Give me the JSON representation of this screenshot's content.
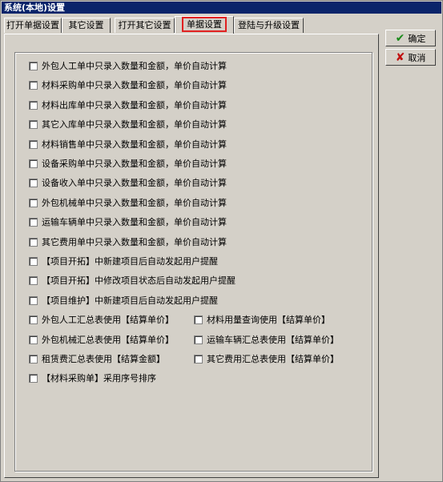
{
  "window": {
    "title": "系统(本地)设置"
  },
  "tabs": [
    {
      "label": "打开单据设置"
    },
    {
      "label": "其它设置"
    },
    {
      "label": "打开其它设置"
    },
    {
      "label": "单据设置"
    },
    {
      "label": "登陆与升级设置"
    }
  ],
  "active_tab": "单据设置",
  "buttons": {
    "ok_label": "确定",
    "cancel_label": "取消"
  },
  "options": [
    {
      "label": "外包人工单中只录入数量和金额，单价自动计算",
      "checked": false
    },
    {
      "label": "材料采购单中只录入数量和金额，单价自动计算",
      "checked": false
    },
    {
      "label": "材料出库单中只录入数量和金额，单价自动计算",
      "checked": false
    },
    {
      "label": "其它入库单中只录入数量和金额，单价自动计算",
      "checked": false
    },
    {
      "label": "材料销售单中只录入数量和金额，单价自动计算",
      "checked": false
    },
    {
      "label": "设备采购单中只录入数量和金额，单价自动计算",
      "checked": false
    },
    {
      "label": "设备收入单中只录入数量和金额，单价自动计算",
      "checked": false
    },
    {
      "label": "外包机械单中只录入数量和金额，单价自动计算",
      "checked": false
    },
    {
      "label": "运输车辆单中只录入数量和金额，单价自动计算",
      "checked": false
    },
    {
      "label": "其它费用单中只录入数量和金额，单价自动计算",
      "checked": false
    },
    {
      "label": "【项目开拓】中新建项目后自动发起用户提醒",
      "checked": false
    },
    {
      "label": "【项目开拓】中修改项目状态后自动发起用户提醒",
      "checked": false
    },
    {
      "label": "【项目维护】中新建项目后自动发起用户提醒",
      "checked": false
    }
  ],
  "pair_options": [
    {
      "left": "外包人工汇总表使用【结算单价】",
      "right": "材料用量查询使用【结算单价】"
    },
    {
      "left": "外包机械汇总表使用【结算单价】",
      "right": "运输车辆汇总表使用【结算单价】"
    },
    {
      "left": "租赁费汇总表使用【结算金额】",
      "right": "其它费用汇总表使用【结算单价】"
    }
  ],
  "last_option": {
    "label": "【材料采购单】采用序号排序",
    "checked": false
  }
}
